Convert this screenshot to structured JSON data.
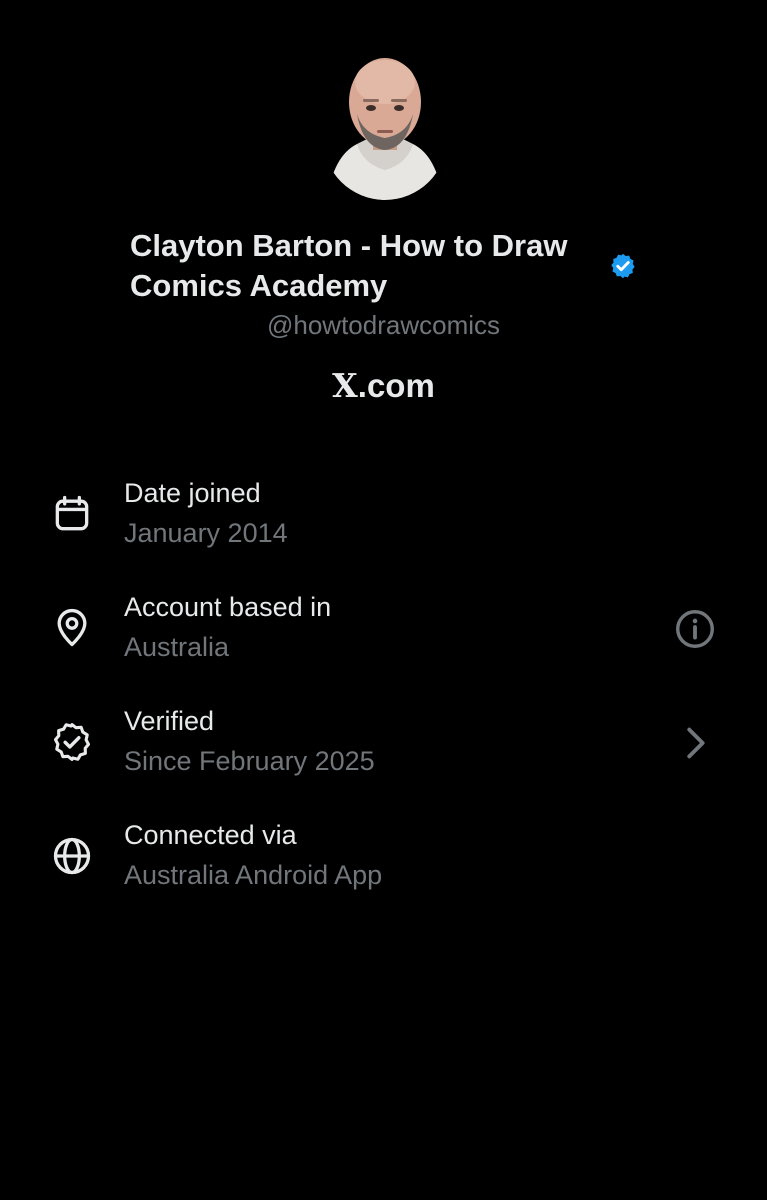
{
  "profile": {
    "display_name": "Clayton Barton - How to Draw Comics Academy",
    "handle": "@howtodrawcomics",
    "site": "X.com",
    "verified": true
  },
  "details": [
    {
      "icon": "calendar-icon",
      "title": "Date joined",
      "value": "January 2014"
    },
    {
      "icon": "location-pin-icon",
      "title": "Account based in",
      "value": "Australia",
      "action_icon": "info-icon"
    },
    {
      "icon": "verified-check-icon",
      "title": "Verified",
      "value": "Since February 2025",
      "action_icon": "chevron-right-icon"
    },
    {
      "icon": "globe-icon",
      "title": "Connected via",
      "value": "Australia Android App"
    }
  ],
  "colors": {
    "background": "#000000",
    "primary_text": "#e7e9ea",
    "secondary_text": "#71767b",
    "verified_blue": "#1d9bf0"
  }
}
